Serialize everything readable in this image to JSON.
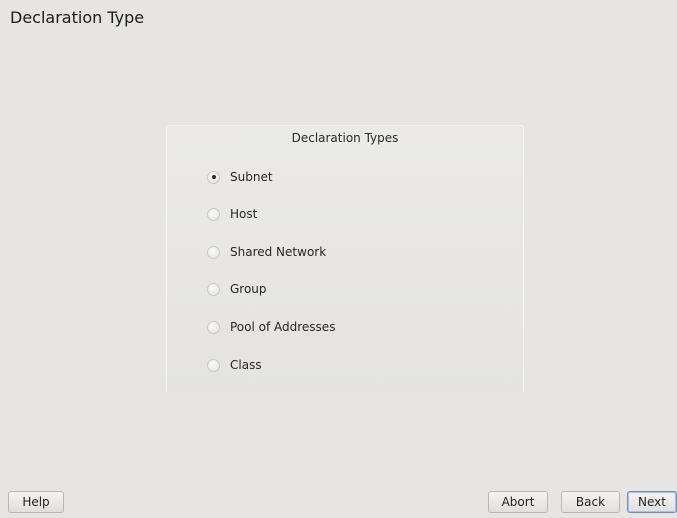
{
  "page": {
    "title": "Declaration Type"
  },
  "group": {
    "title": "Declaration Types",
    "options": [
      {
        "label": "Subnet",
        "checked": true
      },
      {
        "label": "Host",
        "checked": false
      },
      {
        "label": "Shared Network",
        "checked": false
      },
      {
        "label": "Group",
        "checked": false
      },
      {
        "label": "Pool of Addresses",
        "checked": false
      },
      {
        "label": "Class",
        "checked": false
      }
    ]
  },
  "buttons": {
    "help": "Help",
    "abort": "Abort",
    "back": "Back",
    "next": "Next"
  }
}
